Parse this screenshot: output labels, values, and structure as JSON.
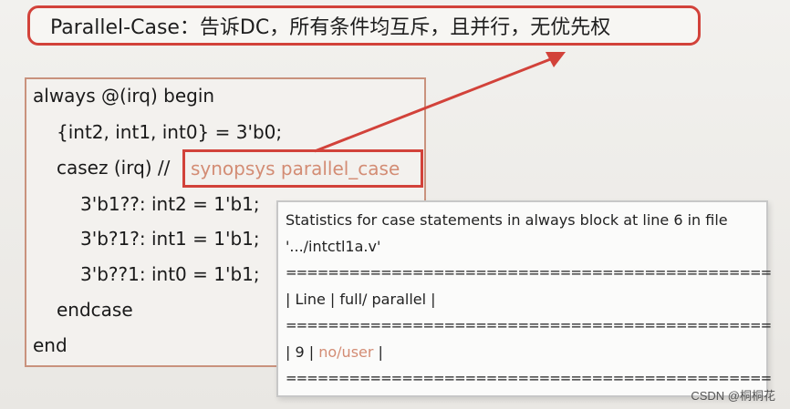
{
  "title": {
    "text": "Parallel-Case：告诉DC，所有条件均互斥，且并行，无优先权"
  },
  "code": {
    "line1": "always @(irq) begin",
    "line2": "{int2, int1, int0} = 3'b0;",
    "line3_prefix": "casez (irq) //",
    "line3_comment": "synopsys parallel_case",
    "line4": "3'b1??: int2 = 1'b1;",
    "line5": "3'b?1?: int1 = 1'b1;",
    "line6": "3'b??1: int0 = 1'b1;",
    "line7": "endcase",
    "line8": "end"
  },
  "stats": {
    "line1": "Statistics for case statements in always block at line 6 in file",
    "line2": "'.../intctl1a.v'",
    "separator": "==============================================",
    "header": "| Line | full/ parallel |",
    "row_prefix": "| 9 |",
    "row_value": "no/user",
    "row_suffix": "|"
  },
  "watermark": "CSDN @桐桐花",
  "colors": {
    "accent_red": "#d2423a",
    "comment_salmon": "#d38c74",
    "code_border": "#c9927d"
  }
}
